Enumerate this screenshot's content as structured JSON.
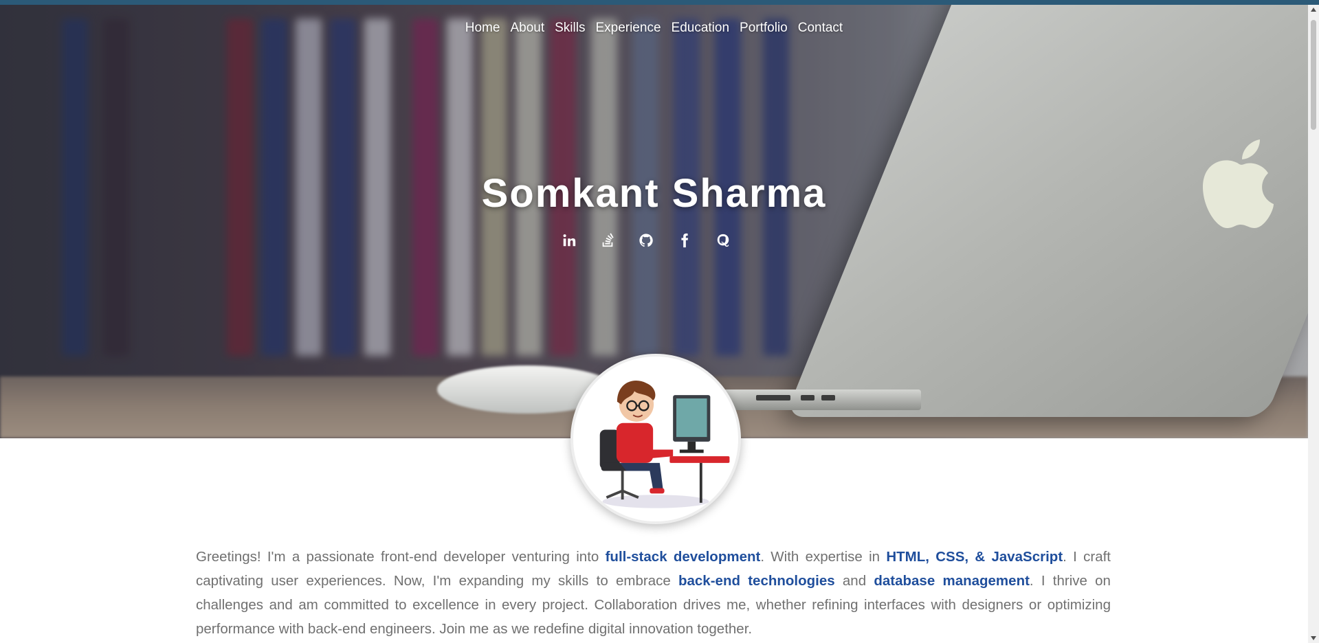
{
  "nav": {
    "items": [
      {
        "label": "Home"
      },
      {
        "label": "About"
      },
      {
        "label": "Skills"
      },
      {
        "label": "Experience"
      },
      {
        "label": "Education"
      },
      {
        "label": "Portfolio"
      },
      {
        "label": "Contact"
      }
    ]
  },
  "hero": {
    "name": "Somkant Sharma",
    "socials": [
      "linkedin-icon",
      "stack-overflow-icon",
      "github-icon",
      "facebook-icon",
      "quora-icon"
    ]
  },
  "about": {
    "p1": "Greetings! I'm a passionate front-end developer venturing into ",
    "h1": "full-stack development",
    "p2": ". With expertise in ",
    "h2": "HTML, CSS, & JavaScript",
    "p3": ". I craft captivating user experiences. Now, I'm expanding my skills to embrace ",
    "h3": "back-end technologies",
    "p4": " and ",
    "h4": "database management",
    "p5": ". I thrive on challenges and am committed to excellence in every project. Collaboration drives me, whether refining interfaces with designers or optimizing performance with back-end engineers. Join me as we redefine digital innovation together."
  },
  "colors": {
    "highlight": "#1f4e9c",
    "body_text": "#707070",
    "topbar": "#2b5a78"
  }
}
